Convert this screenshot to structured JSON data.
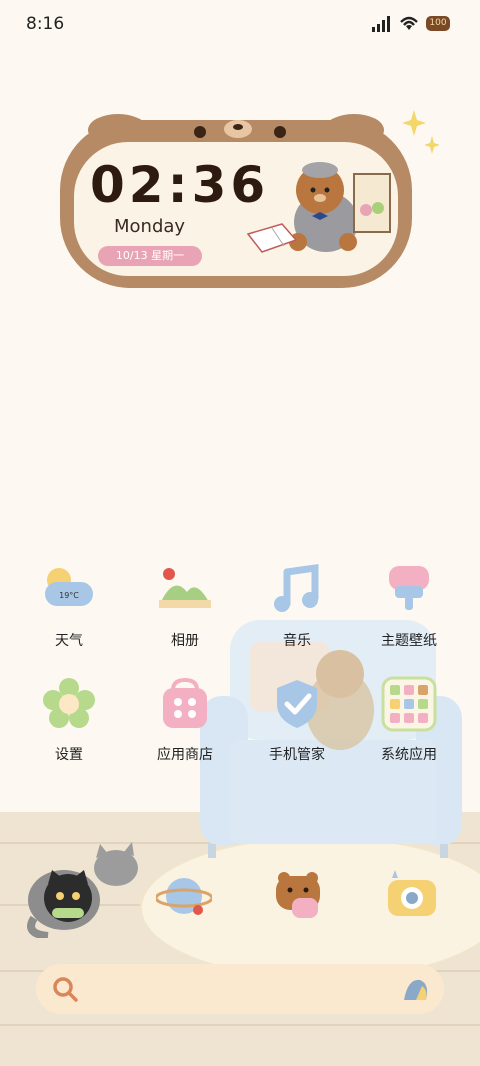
{
  "status_bar": {
    "time": "8:16",
    "battery": "100"
  },
  "clock_widget": {
    "time": "02:36",
    "day": "Monday",
    "date": "10/13  星期一"
  },
  "apps": [
    {
      "label": "天气",
      "icon": "weather-icon",
      "temp": "19°C"
    },
    {
      "label": "相册",
      "icon": "gallery-icon"
    },
    {
      "label": "音乐",
      "icon": "music-icon"
    },
    {
      "label": "主题壁纸",
      "icon": "themes-icon"
    },
    {
      "label": "设置",
      "icon": "settings-icon"
    },
    {
      "label": "应用商店",
      "icon": "app-store-icon"
    },
    {
      "label": "手机管家",
      "icon": "phone-manager-icon"
    },
    {
      "label": "系统应用",
      "icon": "system-apps-folder-icon"
    }
  ],
  "dock": [
    {
      "icon": "phone-cat-icon"
    },
    {
      "icon": "browser-planet-icon"
    },
    {
      "icon": "messages-bear-icon"
    },
    {
      "icon": "camera-icon"
    }
  ],
  "colors": {
    "background": "#fdf9f2",
    "clock_frame": "#b58a65",
    "date_pill": "#e8a4b4",
    "search_bar": "#fbe9cf"
  }
}
